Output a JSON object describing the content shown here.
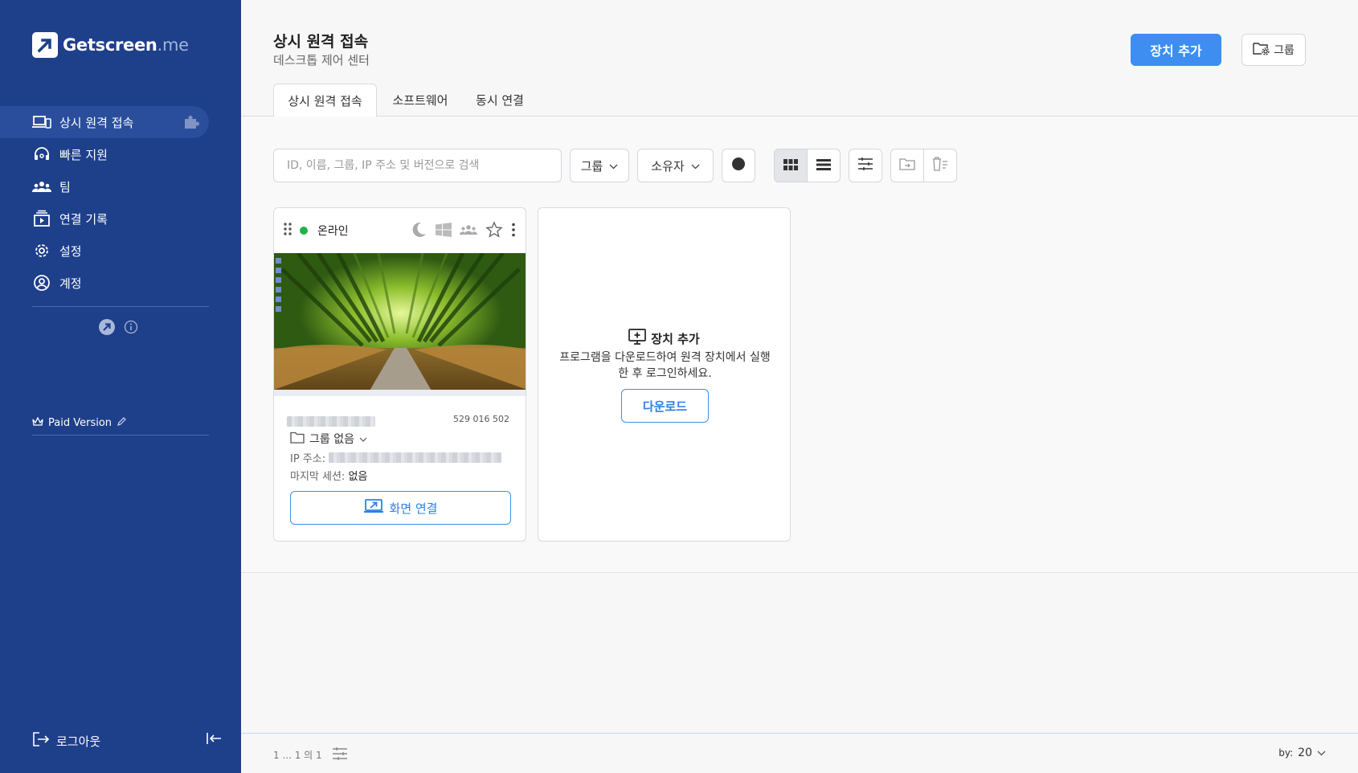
{
  "app": {
    "logo_name": "Getscreen",
    "logo_tld": ".me"
  },
  "sidebar": {
    "items": [
      {
        "label": "상시 원격 접속",
        "icon": "devices-icon",
        "active": true
      },
      {
        "label": "빠른 지원",
        "icon": "headset-icon"
      },
      {
        "label": "팀",
        "icon": "team-icon"
      },
      {
        "label": "연결 기록",
        "icon": "history-icon"
      },
      {
        "label": "설정",
        "icon": "gear-icon"
      },
      {
        "label": "계정",
        "icon": "account-icon"
      }
    ],
    "paid_version": "Paid Version",
    "logout": "로그아웃"
  },
  "header": {
    "title": "상시 원격 접속",
    "subtitle": "데스크톱 제어 센터",
    "add_device": "장치 추가",
    "group_button": "그룹"
  },
  "tabs": [
    {
      "label": "상시 원격 접속",
      "active": true
    },
    {
      "label": "소프트웨어"
    },
    {
      "label": "동시 연결"
    }
  ],
  "toolbar": {
    "search_placeholder": "ID, 이름, 그룹, IP 주소 및 버전으로 검색",
    "group_filter": "그룹",
    "owner_filter": "소유자"
  },
  "device_card": {
    "status": "온라인",
    "device_id": "529 016 502",
    "group": "그룹 없음",
    "ip_label": "IP 주소:",
    "last_session_label": "마지막 세션:",
    "last_session_value": "없음",
    "connect": "화면 연결"
  },
  "add_card": {
    "title": "장치 추가",
    "description": "프로그램을 다운로드하여 원격 장치에서 실행한 후 로그인하세요.",
    "download": "다운로드"
  },
  "footer": {
    "pagination": "1 ... 1 의 1",
    "per_page_label": "by:",
    "per_page_value": "20"
  },
  "colors": {
    "sidebar": "#1e3f8a",
    "accent": "#3d8ef0",
    "online": "#22b14c"
  }
}
